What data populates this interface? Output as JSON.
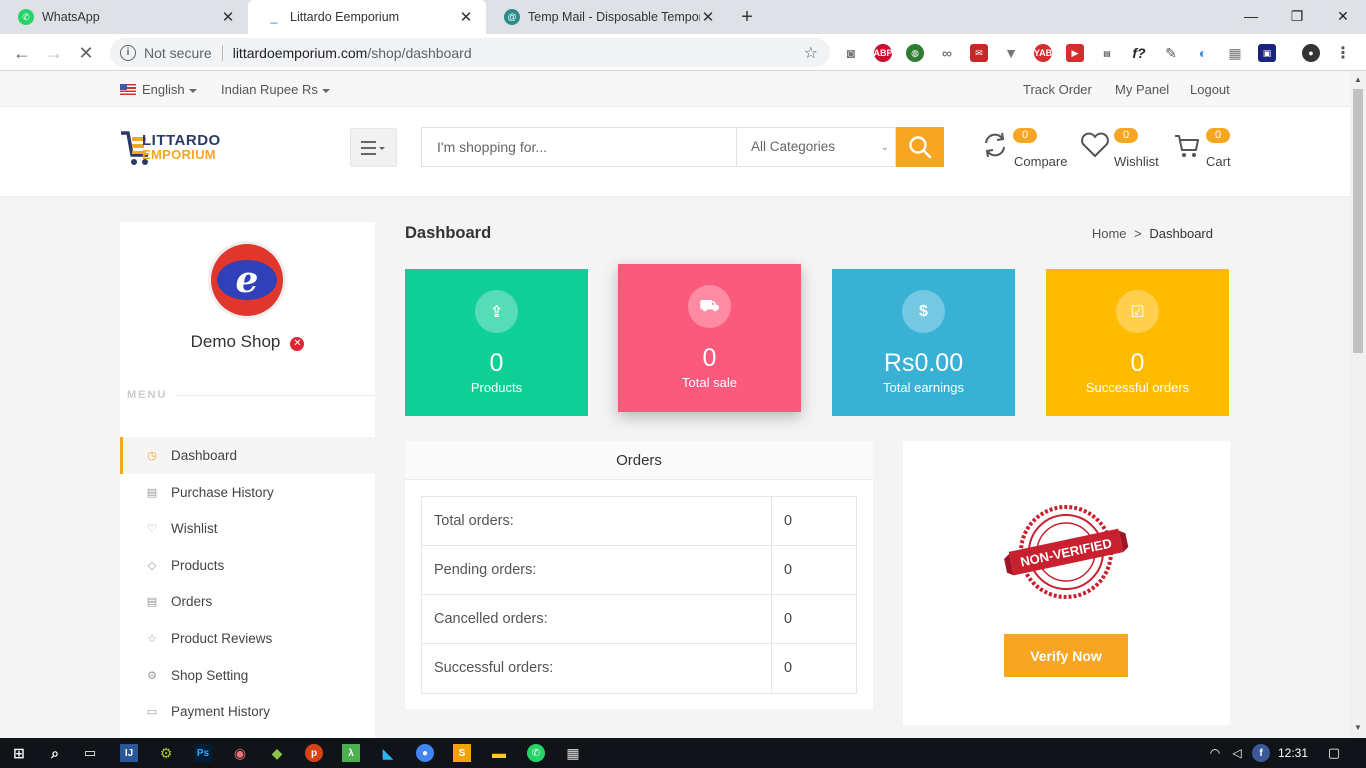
{
  "browser": {
    "tabs": [
      {
        "title": "WhatsApp",
        "active": false
      },
      {
        "title": "Littardo Eemporium",
        "active": true
      },
      {
        "title": "Temp Mail - Disposable Tempora",
        "active": false
      }
    ],
    "omnibox": {
      "security": "Not secure",
      "host": "littardoemporium.com",
      "path": "/shop/dashboard"
    }
  },
  "topbar": {
    "language": "English",
    "currency": "Indian Rupee Rs",
    "links": [
      "Track Order",
      "My Panel",
      "Logout"
    ]
  },
  "header": {
    "logo_line1": "LITTARDO",
    "logo_line2": "EMPORIUM",
    "search_placeholder": "I'm shopping for...",
    "category": "All Categories",
    "compare": {
      "label": "Compare",
      "count": "0"
    },
    "wishlist": {
      "label": "Wishlist",
      "count": "0"
    },
    "cart": {
      "label": "Cart",
      "count": "0"
    }
  },
  "sidebar": {
    "avatar_letter": "e",
    "shop_name": "Demo Shop",
    "menu_label": "MENU",
    "items": [
      {
        "label": "Dashboard",
        "icon": "dashboard-icon",
        "active": true
      },
      {
        "label": "Purchase History",
        "icon": "file-icon"
      },
      {
        "label": "Wishlist",
        "icon": "heart-icon"
      },
      {
        "label": "Products",
        "icon": "diamond-icon"
      },
      {
        "label": "Orders",
        "icon": "file-icon"
      },
      {
        "label": "Product Reviews",
        "icon": "star-icon"
      },
      {
        "label": "Shop Setting",
        "icon": "gear-icon"
      },
      {
        "label": "Payment History",
        "icon": "card-icon"
      }
    ]
  },
  "main": {
    "title": "Dashboard",
    "breadcrumb": {
      "home": "Home",
      "sep": ">",
      "current": "Dashboard"
    },
    "stats": [
      {
        "value": "0",
        "label": "Products",
        "color": "#0fcf97",
        "icon": "upload-icon"
      },
      {
        "value": "0",
        "label": "Total sale",
        "color": "#fb5a7c",
        "icon": "cart-icon"
      },
      {
        "value": "Rs0.00",
        "label": "Total earnings",
        "color": "#38b1d4",
        "icon": "dollar-icon"
      },
      {
        "value": "0",
        "label": "Successful orders",
        "color": "#ffbb00",
        "icon": "check-icon"
      }
    ],
    "orders": {
      "title": "Orders",
      "rows": [
        {
          "label": "Total orders:",
          "value": "0"
        },
        {
          "label": "Pending orders:",
          "value": "0"
        },
        {
          "label": "Cancelled orders:",
          "value": "0"
        },
        {
          "label": "Successful orders:",
          "value": "0"
        }
      ]
    },
    "verify": {
      "stamp_text": "NON-VERIFIED",
      "button": "Verify Now"
    }
  },
  "taskbar": {
    "clock": "12:31"
  }
}
